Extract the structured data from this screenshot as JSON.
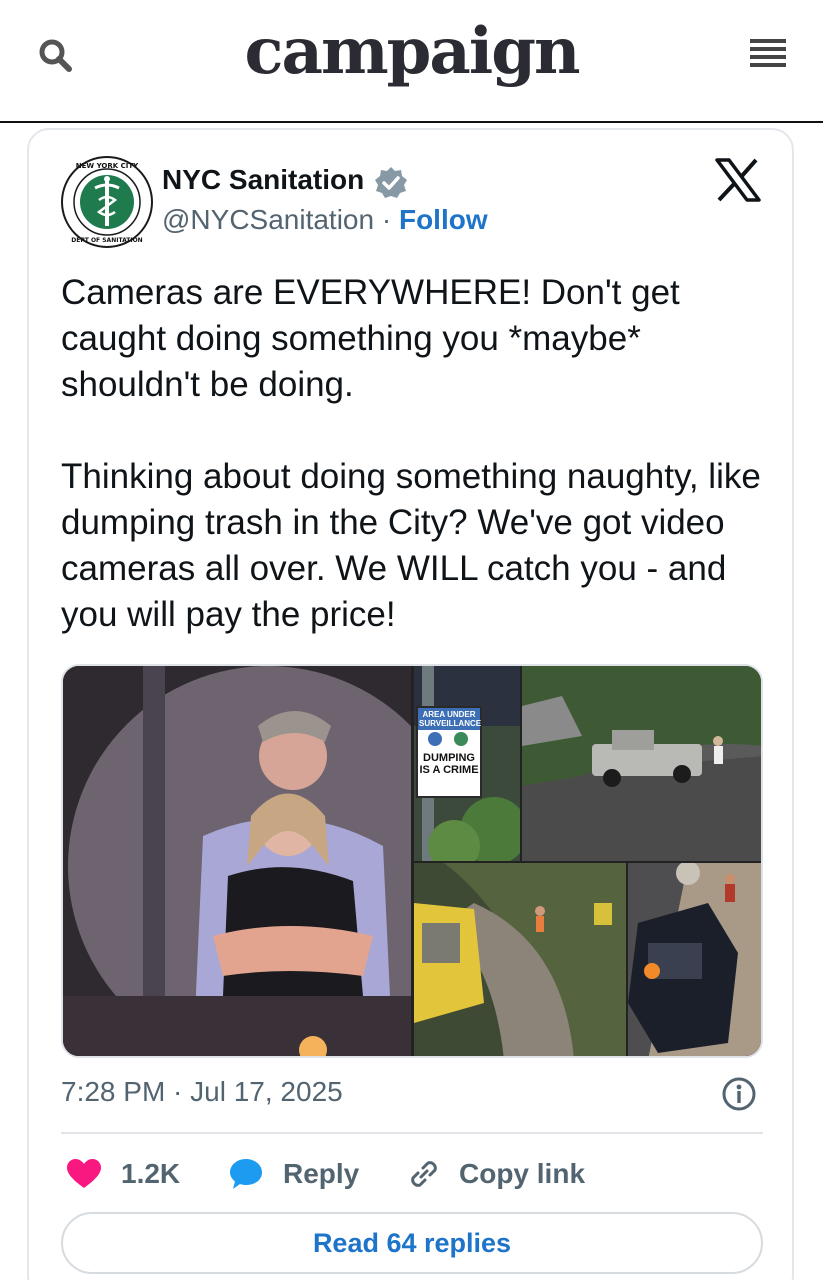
{
  "header": {
    "logo": "campaign",
    "search_icon": "search-icon",
    "menu_icon": "hamburger-menu-icon"
  },
  "tweet": {
    "author_name": "NYC Sanitation",
    "handle": "@NYCSanitation",
    "separator": " · ",
    "follow_label": "Follow",
    "verified": true,
    "avatar_seal_text": "NEW YORK CITY · DEPARTMENT OF SANITATION",
    "text": "Cameras are EVERYWHERE! Don't get caught doing something you *maybe* shouldn't be doing.\n\nThinking about doing something naughty, like dumping trash in the City? We've got video cameras all over. We WILL catch you - and you will pay the price!",
    "media_sign": {
      "band": "AREA UNDER SURVEILLANCE",
      "text": "DUMPING IS A CRIME"
    },
    "timestamp": "7:28 PM · Jul 17, 2025",
    "actions": {
      "likes": "1.2K",
      "reply_label": "Reply",
      "copy_link_label": "Copy link"
    },
    "read_replies_label": "Read 64 replies"
  },
  "colors": {
    "link_blue": "#1d74c9",
    "like_pink": "#f91880",
    "reply_blue": "#1d9bf0",
    "muted_text": "#536471"
  }
}
